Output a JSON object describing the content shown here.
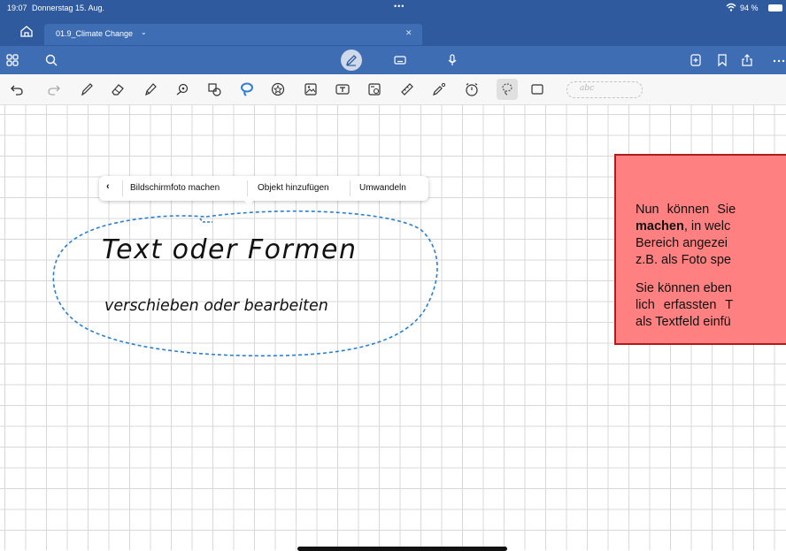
{
  "status_bar": {
    "time": "19:07",
    "date": "Donnerstag 15. Aug.",
    "battery": "94 %"
  },
  "tabs": {
    "document_title": "01.9_Climate Change"
  },
  "context_menu": {
    "back": "‹",
    "items": [
      "Bildschirmfoto machen",
      "Objekt hinzufügen",
      "Umwandeln"
    ]
  },
  "handwriting_field": {
    "placeholder": "abc"
  },
  "canvas": {
    "handwriting_line1": "Text oder Formen",
    "handwriting_line2": "verschieben oder bearbeiten"
  },
  "callout": {
    "line1": "Nun können Sie",
    "line2_bold": "machen",
    "line2_rest": ", in welc",
    "line3": "Bereich angezei",
    "line4": "z.B. als Foto spe",
    "line5": "Sie können eben",
    "line6": "lich erfassten T",
    "line7": "als Textfeld einfü"
  },
  "colors": {
    "tabbar": "#2f5b9e",
    "navbar": "#3e6db3",
    "lasso": "#2a7fd4",
    "callout_fill": "#ff8080",
    "callout_border": "#b01c1c"
  }
}
